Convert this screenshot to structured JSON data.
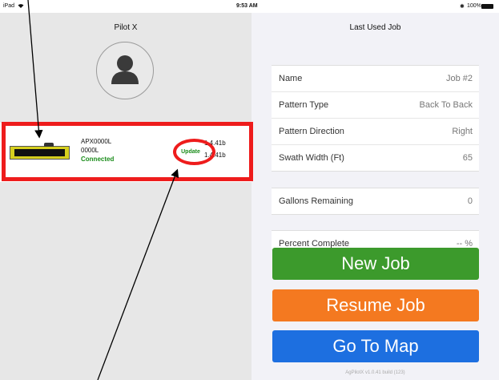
{
  "status_bar": {
    "device": "iPad",
    "time": "9:53 AM",
    "battery": "100%"
  },
  "left_panel": {
    "title": "Pilot X",
    "device": {
      "name_line1": "APX0000L",
      "name_line2": "0000L",
      "status": "Connected",
      "update_label": "Update",
      "version1": "1.4.41b",
      "version2": "1.4.41b"
    }
  },
  "right_panel": {
    "title": "Last Used Job",
    "job_details": [
      {
        "label": "Name",
        "value": "Job #2"
      },
      {
        "label": "Pattern Type",
        "value": "Back To Back"
      },
      {
        "label": "Pattern Direction",
        "value": "Right"
      },
      {
        "label": "Swath Width (Ft)",
        "value": "65"
      }
    ],
    "gallons": {
      "label": "Gallons Remaining",
      "value": "0"
    },
    "percent": {
      "label": "Percent Complete",
      "value": "-- %"
    },
    "buttons": {
      "new_job": "New Job",
      "resume_job": "Resume Job",
      "go_to_map": "Go To Map"
    },
    "footer": "AgPilotX v1.0.41 build (123)"
  },
  "colors": {
    "new_job": "#3c9a2c",
    "resume_job": "#f47920",
    "go_to_map": "#1d6fe0",
    "highlight": "#ee1c1c",
    "connected": "#1a8c1a"
  }
}
